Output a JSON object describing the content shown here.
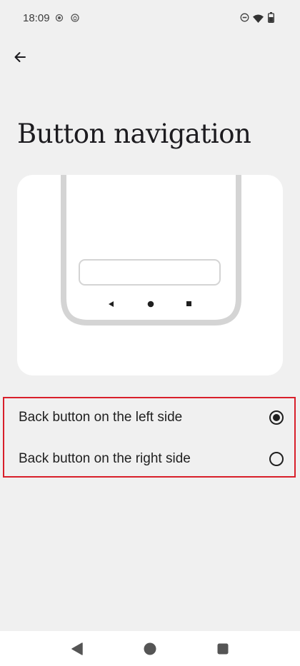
{
  "status_bar": {
    "time": "18:09"
  },
  "header": {
    "title": "Button navigation"
  },
  "options": [
    {
      "label": "Back button on the left side",
      "selected": true
    },
    {
      "label": "Back button on the right side",
      "selected": false
    }
  ],
  "colors": {
    "background": "#f0f0f0",
    "card": "#ffffff",
    "highlight_border": "#d81f2a",
    "illustration_gray": "#d4d4d4"
  }
}
